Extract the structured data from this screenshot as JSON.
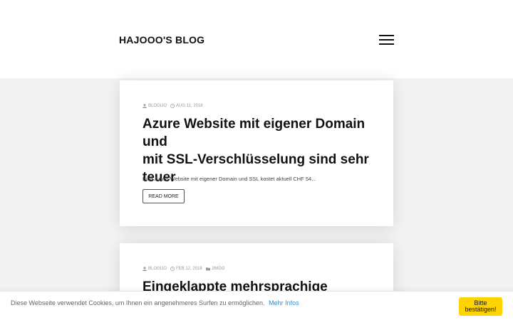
{
  "header": {
    "site_title": "HAJOOO'S BLOG",
    "menu_icon": "hamburger-menu-icon"
  },
  "posts": [
    {
      "author": "BLOGIJO",
      "date": "AUG 11, 2018",
      "title_lines": [
        "Azure Website mit eigener Domain und",
        "mit SSL-Verschlüsselung sind sehr",
        "teuer"
      ],
      "excerpt": "Eine Azure-Website mit eigener Domain und SSL kostet aktuell CHF 54...",
      "read_more_label": "READ MORE"
    },
    {
      "author": "BLOGIJO",
      "date": "FEB 12, 2018",
      "category": "JIMDO",
      "title_lines": [
        "Eingeklappte mehrsprachige"
      ]
    }
  ],
  "cookie": {
    "text": "Diese Webseite verwendet Cookies, um Ihnen ein angenehmeres Surfen zu ermöglichen.",
    "link_label": "Mehr Infos",
    "button_label_line1": "Bitte",
    "button_label_line2": "bestätigen!",
    "button_color": "#ffd400",
    "link_color": "#3a8dc8"
  }
}
